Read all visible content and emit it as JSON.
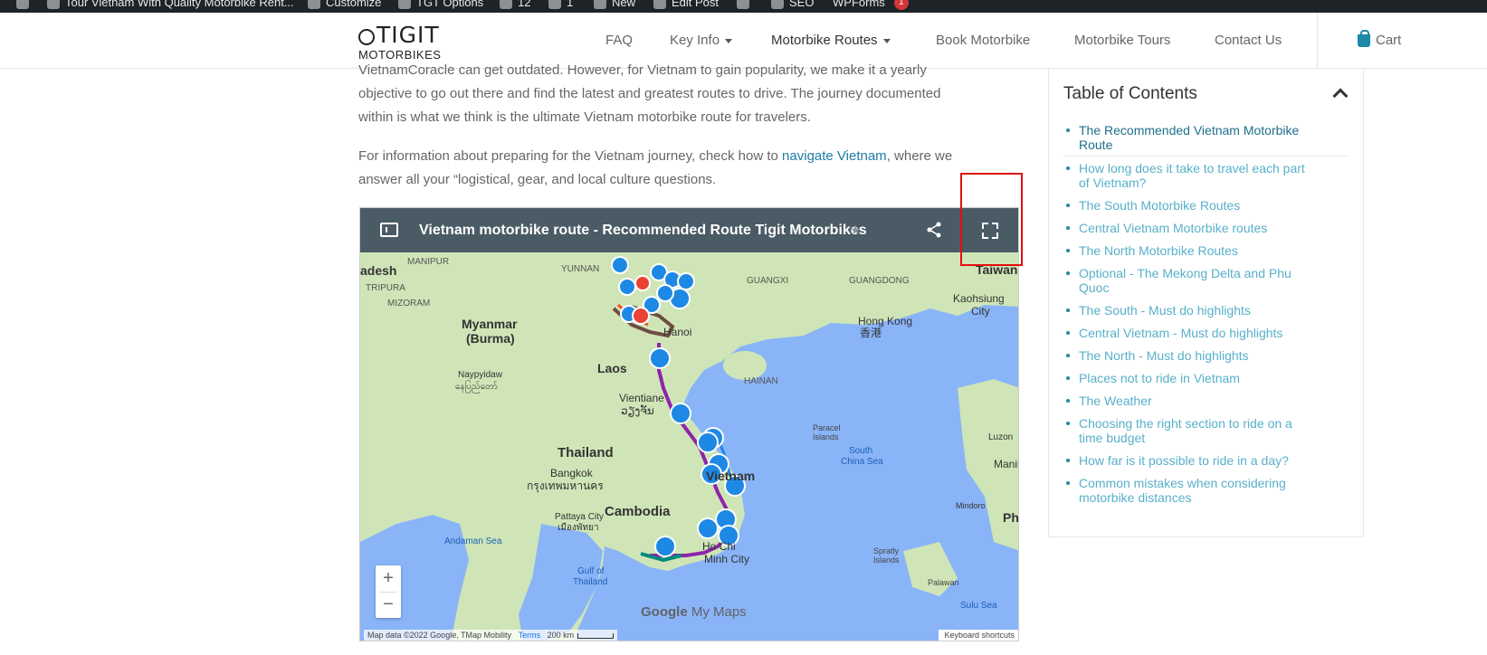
{
  "adminbar": {
    "items": [
      {
        "label": "Tour Vietnam With Quality Motorbike Rent..."
      },
      {
        "label": "Customize"
      },
      {
        "label": "TGT Options"
      },
      {
        "label": "12"
      },
      {
        "label": "1"
      },
      {
        "label": "New"
      },
      {
        "label": "Edit Post"
      },
      {
        "label": "SEO"
      },
      {
        "label": "WPForms",
        "badge": "1"
      }
    ]
  },
  "header": {
    "logo_top": "TIGIT",
    "logo_bottom": "MOTORBIKES",
    "nav": [
      {
        "label": "FAQ"
      },
      {
        "label": "Key Info"
      },
      {
        "label": "Motorbike Routes"
      },
      {
        "label": "Book Motorbike"
      },
      {
        "label": "Motorbike Tours"
      },
      {
        "label": "Contact Us"
      }
    ],
    "cart": "Cart"
  },
  "article": {
    "para1_line1": "VietnamCoracle can get outdated. However, for Vietnam to gain popularity, we make it a yearly",
    "para1_line2": "objective to go out there and find the latest and greatest routes to drive. The journey documented",
    "para1_line3": "within is what we think is the ultimate Vietnam motorbike route for travelers.",
    "para2_before": "For information about preparing for the Vietnam journey, check how to ",
    "para2_link": "navigate Vietnam",
    "para2_after": ", where we",
    "para2_line2": "answer all your “logistical, gear, and local culture questions."
  },
  "map": {
    "title": "Vietnam motorbike route - Recommended Route Tigit Motorbikes",
    "zoom_in": "+",
    "zoom_out": "−",
    "google": "Google",
    "mymaps": "My Maps",
    "attribution": "Map data ©2022 Google, TMap Mobility",
    "terms": "Terms",
    "scale": "200 km",
    "keyboard": "Keyboard shortcuts",
    "labels": [
      {
        "text": "adesh"
      },
      {
        "text": "MANIPUR"
      },
      {
        "text": "TRIPURA"
      },
      {
        "text": "MIZORAM"
      },
      {
        "text": "YUNNAN"
      },
      {
        "text": "GUANGXI"
      },
      {
        "text": "GUANGDONG"
      },
      {
        "text": "Taiwan"
      },
      {
        "text": "Myanmar"
      },
      {
        "text": "(Burma)"
      },
      {
        "text": "Hong Kong"
      },
      {
        "text": "香港"
      },
      {
        "text": "Kaohsiung"
      },
      {
        "text": "City"
      },
      {
        "text": "Hanoi"
      },
      {
        "text": "Laos"
      },
      {
        "text": "HAINAN"
      },
      {
        "text": "Naypyidaw"
      },
      {
        "text": "နေပြည်တော်"
      },
      {
        "text": "Vientiane"
      },
      {
        "text": "ວຽງຈັນ"
      },
      {
        "text": "Paracel"
      },
      {
        "text": "Islands"
      },
      {
        "text": "Thailand"
      },
      {
        "text": "South"
      },
      {
        "text": "China Sea"
      },
      {
        "text": "Luzon"
      },
      {
        "text": "Bangkok"
      },
      {
        "text": "กรุงเทพมหานคร"
      },
      {
        "text": "Vietnam"
      },
      {
        "text": "Manila"
      },
      {
        "text": "Cambodia"
      },
      {
        "text": "Mindoro"
      },
      {
        "text": "Ph"
      },
      {
        "text": "Pattaya City"
      },
      {
        "text": "เมืองพัทยา"
      },
      {
        "text": "Andaman Sea"
      },
      {
        "text": "Ho Chi"
      },
      {
        "text": "Minh City"
      },
      {
        "text": "Spratly"
      },
      {
        "text": "Islands"
      },
      {
        "text": "Gulf of"
      },
      {
        "text": "Thailand"
      },
      {
        "text": "Palawan"
      },
      {
        "text": "Sulu Sea"
      }
    ]
  },
  "toc": {
    "title": "Table of Contents",
    "items": [
      {
        "line1": "The Recommended Vietnam Motorbike",
        "line2": "Route"
      },
      {
        "line1": "How long does it take to travel each part",
        "line2": "of Vietnam?"
      },
      {
        "line1": "The South Motorbike Routes",
        "line2": ""
      },
      {
        "line1": "Central Vietnam Motorbike routes",
        "line2": ""
      },
      {
        "line1": "The North Motorbike Routes",
        "line2": ""
      },
      {
        "line1": "Optional - The Mekong Delta and Phu",
        "line2": "Quoc"
      },
      {
        "line1": "The South - Must do highlights",
        "line2": ""
      },
      {
        "line1": "Central Vietnam - Must do highlights",
        "line2": ""
      },
      {
        "line1": "The North - Must do highlights",
        "line2": ""
      },
      {
        "line1": "Places not to ride in Vietnam",
        "line2": ""
      },
      {
        "line1": "The Weather",
        "line2": ""
      },
      {
        "line1": "Choosing the right section to ride on a",
        "line2": "time budget"
      },
      {
        "line1": "How far is it possible to ride in a day?",
        "line2": ""
      },
      {
        "line1": "Common mistakes when considering",
        "line2": "motorbike distances"
      }
    ]
  }
}
